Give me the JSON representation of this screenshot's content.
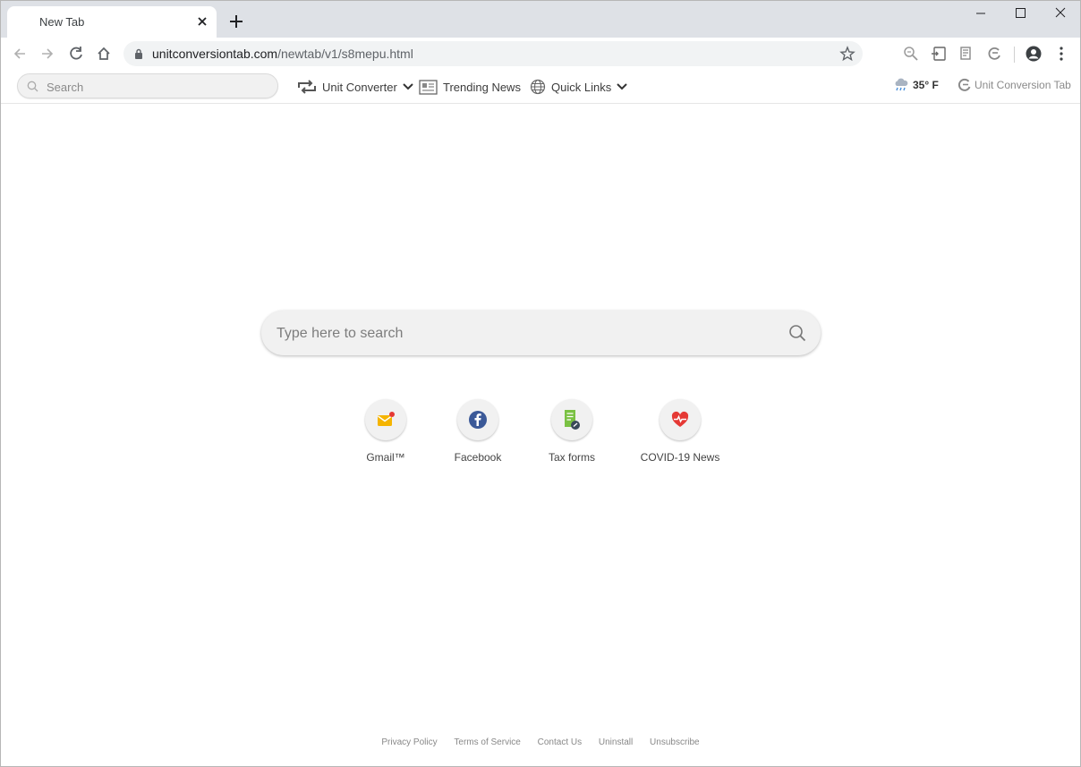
{
  "browser": {
    "tab_title": "New Tab",
    "url_host": "unitconversiontab.com",
    "url_path": "/newtab/v1/s8mepu.html"
  },
  "extension_bar": {
    "search_placeholder": "Search",
    "unit_converter_label": "Unit Converter",
    "trending_news_label": "Trending News",
    "quick_links_label": "Quick Links",
    "weather_temp": "35° F",
    "brand_name": "Unit Conversion Tab"
  },
  "main": {
    "search_placeholder": "Type here to search",
    "shortcuts": [
      {
        "label": "Gmail™",
        "icon": "gmail-icon"
      },
      {
        "label": "Facebook",
        "icon": "facebook-icon"
      },
      {
        "label": "Tax forms",
        "icon": "tax-forms-icon"
      },
      {
        "label": "COVID-19 News",
        "icon": "covid-news-icon"
      }
    ]
  },
  "footer": {
    "links": [
      "Privacy Policy",
      "Terms of Service",
      "Contact Us",
      "Uninstall",
      "Unsubscribe"
    ]
  },
  "colors": {
    "tabstrip": "#dee1e6",
    "omnibox": "#f1f3f4",
    "facebook": "#3b5998",
    "gmail": "#f5b400",
    "tax": "#7ac143",
    "covid": "#e53935"
  }
}
